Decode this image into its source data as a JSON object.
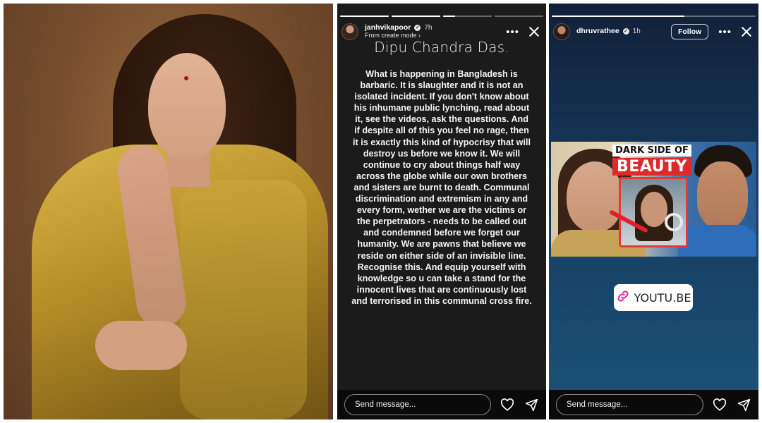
{
  "story_1": {
    "username": "janhvikapoor",
    "time": "7h",
    "subtitle": "From create mode",
    "progress": [
      1.0,
      1.0,
      0.25,
      0.0
    ],
    "title": "Dipu Chandra Das.",
    "body": "What is happening in Bangladesh is barbaric. It is slaughter and it is not an isolated incident. If you don't know about his inhumane public lynching, read about it, see the videos, ask the questions. And if despite all of this you feel no rage, then it is exactly this kind of hypocrisy that will destroy us before we know it. We will continue to cry about things half way across the globe while our own brothers and sisters are burnt to death. Communal discrimination and extremism in any and every form, wether we are the victims or the perpetrators - needs to be called out and condemned before we forget our humanity. We are pawns that believe we reside on either side of  an invisible line. Recognise this. And equip yourself with knowledge so u can take a stand for the innocent lives that are continuously lost and terrorised in this communal cross fire.",
    "message_placeholder": "Send message..."
  },
  "story_2": {
    "username": "dhruvrathee",
    "time": "1h",
    "follow_label": "Follow",
    "progress": [
      0.65
    ],
    "thumbnail": {
      "line1": "DARK SIDE OF",
      "line2": "BEAUTY"
    },
    "link_label": "YOUTU.BE",
    "message_placeholder": "Send message..."
  },
  "icons": {
    "more": "more-icon",
    "close": "close-icon",
    "heart": "heart-icon",
    "send": "send-icon",
    "link": "link-icon",
    "verified": "verified-badge-icon"
  },
  "colors": {
    "story_1_bg": "#1b1b1b",
    "story_2_bg_top": "#112038",
    "story_2_bg_bottom": "#1c5478",
    "thumbnail_accent": "#e02a2a"
  }
}
